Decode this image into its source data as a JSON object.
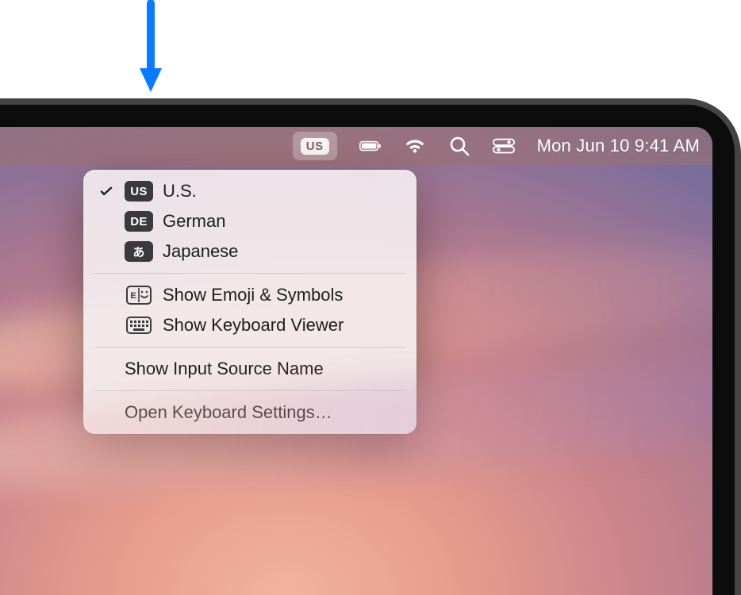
{
  "annotation": {
    "pointer_direction": "down"
  },
  "menubar": {
    "input_source_badge": "US",
    "datetime": "Mon Jun 10  9:41 AM"
  },
  "input_menu": {
    "sources": [
      {
        "badge": "US",
        "label": "U.S.",
        "selected": true
      },
      {
        "badge": "DE",
        "label": "German",
        "selected": false
      },
      {
        "badge": "あ",
        "label": "Japanese",
        "selected": false
      }
    ],
    "show_emoji_label": "Show Emoji & Symbols",
    "show_keyboard_viewer_label": "Show Keyboard Viewer",
    "show_input_source_name_label": "Show Input Source Name",
    "open_keyboard_settings_label": "Open Keyboard Settings…"
  }
}
